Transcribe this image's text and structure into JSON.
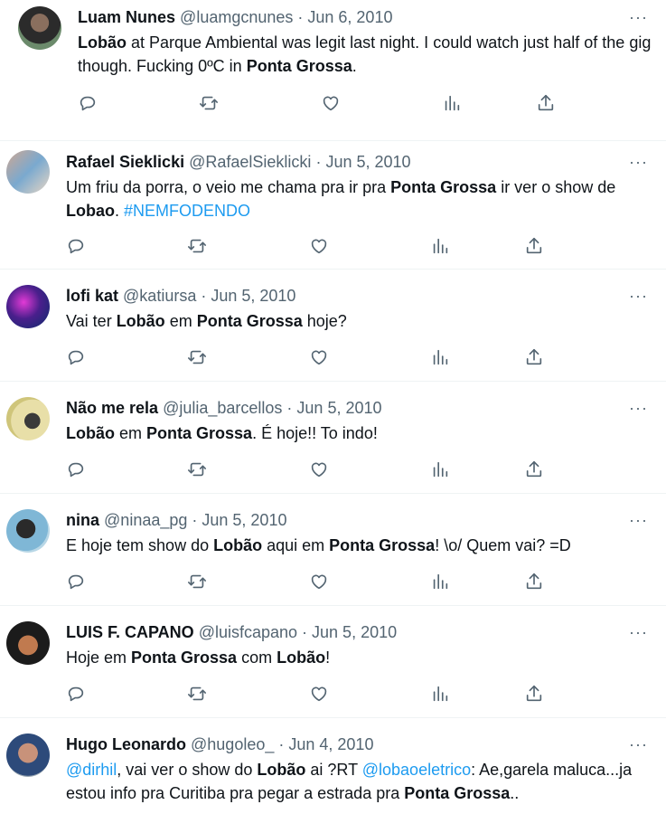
{
  "tweets": [
    {
      "name": "Luam Nunes",
      "handle": "@luamgcnunes",
      "date": "Jun 6, 2010",
      "text": [
        {
          "b": "Lobão"
        },
        {
          "t": " at Parque Ambiental was legit last night. I could watch just half of the gig though. Fucking 0ºC in "
        },
        {
          "b": "Ponta Grossa"
        },
        {
          "t": "."
        }
      ]
    },
    {
      "name": "Rafael Sieklicki",
      "handle": "@RafaelSieklicki",
      "date": "Jun 5, 2010",
      "text": [
        {
          "t": "Um friu da porra, o veio me chama pra ir pra "
        },
        {
          "b": "Ponta Grossa"
        },
        {
          "t": " ir ver o show de "
        },
        {
          "b": "Lobao"
        },
        {
          "t": ". "
        },
        {
          "l": "#NEMFODENDO"
        }
      ]
    },
    {
      "name": "lofi kat",
      "handle": "@katiursa",
      "date": "Jun 5, 2010",
      "text": [
        {
          "t": "Vai ter "
        },
        {
          "b": "Lobão"
        },
        {
          "t": " em "
        },
        {
          "b": "Ponta Grossa"
        },
        {
          "t": " hoje?"
        }
      ]
    },
    {
      "name": "Não me rela",
      "handle": "@julia_barcellos",
      "date": "Jun 5, 2010",
      "text": [
        {
          "b": "Lobão"
        },
        {
          "t": " em "
        },
        {
          "b": "Ponta Grossa"
        },
        {
          "t": ". É hoje!! To indo!"
        }
      ]
    },
    {
      "name": "nina",
      "handle": "@ninaa_pg",
      "date": "Jun 5, 2010",
      "text": [
        {
          "t": "E hoje tem show do "
        },
        {
          "b": "Lobão"
        },
        {
          "t": " aqui em "
        },
        {
          "b": "Ponta Grossa"
        },
        {
          "t": "! \\o/ Quem vai? =D"
        }
      ]
    },
    {
      "name": "LUIS F. CAPANO",
      "handle": "@luisfcapano",
      "date": "Jun 5, 2010",
      "text": [
        {
          "t": "Hoje em "
        },
        {
          "b": "Ponta Grossa"
        },
        {
          "t": " com "
        },
        {
          "b": "Lobão"
        },
        {
          "t": "!"
        }
      ]
    },
    {
      "name": "Hugo Leonardo",
      "handle": "@hugoleo_",
      "date": "Jun 4, 2010",
      "text": [
        {
          "l": "@dirhil"
        },
        {
          "t": ", vai ver o show do "
        },
        {
          "b": "Lobão"
        },
        {
          "t": " ai ?RT "
        },
        {
          "l": "@lobaoeletrico"
        },
        {
          "t": ": Ae,garela maluca...ja estou info pra Curitiba pra pegar a estrada pra "
        },
        {
          "b": "Ponta Grossa"
        },
        {
          "t": ".."
        }
      ]
    }
  ],
  "icons": [
    "reply-icon",
    "retweet-icon",
    "like-icon",
    "views-icon",
    "share-icon",
    "more-icon"
  ],
  "colors": {
    "link": "#1d9bf0",
    "muted": "#536471",
    "text": "#0f1419",
    "divider": "#eff3f4"
  }
}
